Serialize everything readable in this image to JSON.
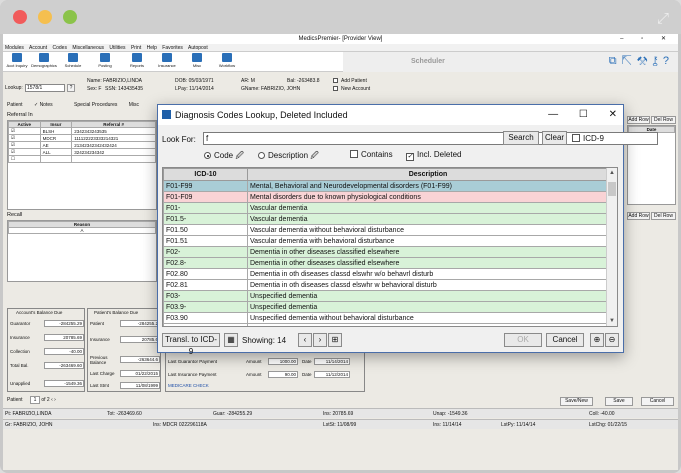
{
  "window": {
    "title": "MedicsPremier- [Provider View]",
    "controls": "– ▫ ✕"
  },
  "menu": [
    "Modules",
    "Account",
    "Codes",
    "Miscellaneous",
    "Utilities",
    "Print",
    "Help",
    "Favorites",
    "Autopost"
  ],
  "toolbar": [
    "Acct Inquiry",
    "Demographics",
    "Schedule",
    "Posting",
    "Reports",
    "Insurance",
    "Misc",
    "Workflow"
  ],
  "scheduler_label": "Scheduler",
  "patient": {
    "lookup_label": "Lookup:",
    "lookup_value": "1578/1",
    "name": "Name: FABRIZIO,LINDA",
    "sex": "Sex: F",
    "ssn": "SSN: 143435435",
    "dob": "DOB: 05/03/1971",
    "lpay": "LPay: 11/14/2014",
    "ar": "AR: M",
    "gname": "GName: FABRIZIO, JOHN",
    "bal": "Bal: -263483.8",
    "add_patient": "Add Patient",
    "new_account": "New Account"
  },
  "tabs": [
    "Patient",
    "Notes",
    "Special Procedures",
    "Misc"
  ],
  "referral": {
    "section": "Referral In",
    "headers": [
      "Active",
      "Insur",
      "Referral #"
    ],
    "rows": [
      [
        "BLSH",
        "2342343243535",
        "908"
      ],
      [
        "MDCR",
        "111122223333214321",
        "908"
      ],
      [
        "AE",
        "21342342342432424",
        ""
      ],
      [
        "ALL",
        "324234234342",
        ""
      ]
    ]
  },
  "side_buttons": {
    "add_row": "Add Row",
    "del_row": "Del Row",
    "date": "Date"
  },
  "recall": {
    "section": "Recall",
    "header": "Reason",
    "row": "A"
  },
  "account_balance": {
    "title": "Account's Balance Due",
    "guarantor": "Guarantor",
    "guarantor_val": "-284255.29",
    "insurance": "Insurance",
    "insurance_val": "20785.69",
    "collection": "Collection",
    "collection_val": "-40.00",
    "total": "Total Bal.",
    "total_val": "-263469.60",
    "unapplied": "Unapplied",
    "unapplied_val": "-1549.36"
  },
  "patient_balance": {
    "title": "Patient's Balance Due",
    "patient": "Patient",
    "patient_val": "-284255.2",
    "insurance": "Insurance",
    "insurance_val": "20785.6",
    "previous": "Previous Balance",
    "previous_val": "-263644.6",
    "last_charge": "Last Charge",
    "last_charge_val": "01/22/2015",
    "last_stmt": "Last Stmt",
    "last_stmt_val": "11/08/1999"
  },
  "payments": {
    "guarantor": "Last Guarantor Payment",
    "g_amount_label": "Amount",
    "g_amount": "1000.00",
    "g_date_label": "Date",
    "g_date": "11/14/2014",
    "insurance": "Last Insurance Payment",
    "i_amount_label": "Amount",
    "i_amount": "90.00",
    "i_date_label": "Date",
    "i_date": "11/12/2014",
    "check": "MEDICARE CHECK"
  },
  "pager": {
    "label": "Patient",
    "current": "1",
    "of": "of 2"
  },
  "bottom_buttons": {
    "save_new": "Save/New",
    "save": "Save",
    "cancel": "Cancel"
  },
  "status1": [
    "Pt: FABRIZIO,LINDA",
    "Tot: -263469.60",
    "Guar: -284255.29",
    "Ins: 20785.69",
    "Unap: -1549.36",
    "Coll: -40.00"
  ],
  "status2": [
    "Gr: FABRIZIO, JOHN",
    "Ins: MDCR 022296118A",
    "LstSt: 11/08/99",
    "Ins: 11/14/14",
    "LstPy: 11/14/14",
    "LstChg: 01/22/15"
  ],
  "dialog": {
    "title": "Diagnosis Codes Lookup, Deleted Included",
    "controls": [
      "—",
      "☐",
      "✕"
    ],
    "look_for_label": "Look For:",
    "look_for_value": "f",
    "search": "Search",
    "clear": "Clear",
    "icd9": "ICD-9",
    "code": "Code",
    "description": "Description",
    "contains": "Contains",
    "incl_deleted": "Incl. Deleted",
    "col_code": "ICD-10",
    "col_desc": "Description",
    "rows": [
      {
        "code": "F01-F99",
        "desc": "Mental, Behavioral and Neurodevelopmental disorders (F01-F99)",
        "style": "sel"
      },
      {
        "code": "F01-F09",
        "desc": "Mental disorders due to known physiological conditions",
        "style": "pink"
      },
      {
        "code": "F01-",
        "desc": "Vascular dementia",
        "style": "green"
      },
      {
        "code": "F01.5-",
        "desc": "Vascular dementia",
        "style": "green"
      },
      {
        "code": "F01.50",
        "desc": "Vascular dementia without behavioral disturbance",
        "style": "white"
      },
      {
        "code": "F01.51",
        "desc": "Vascular dementia with behavioral disturbance",
        "style": "white"
      },
      {
        "code": "F02-",
        "desc": "Dementia in other diseases classified elsewhere",
        "style": "green"
      },
      {
        "code": "F02.8-",
        "desc": "Dementia in other diseases classified elsewhere",
        "style": "green"
      },
      {
        "code": "F02.80",
        "desc": "Dementia in oth diseases classd elswhr w/o behavrl disturb",
        "style": "white"
      },
      {
        "code": "F02.81",
        "desc": "Dementia in oth diseases classd elswhr w behavioral disturb",
        "style": "white"
      },
      {
        "code": "F03-",
        "desc": "Unspecified dementia",
        "style": "green"
      },
      {
        "code": "F03.9-",
        "desc": "Unspecified dementia",
        "style": "green"
      },
      {
        "code": "F03.90",
        "desc": "Unspecified dementia without behavioral disturbance",
        "style": "white"
      },
      {
        "code": "F03.91",
        "desc": "Unspecified dementia with behavioral disturbance",
        "style": "white"
      }
    ],
    "transl": "Transl. to ICD-9",
    "showing": "Showing: 14",
    "ok": "OK",
    "cancel": "Cancel"
  }
}
